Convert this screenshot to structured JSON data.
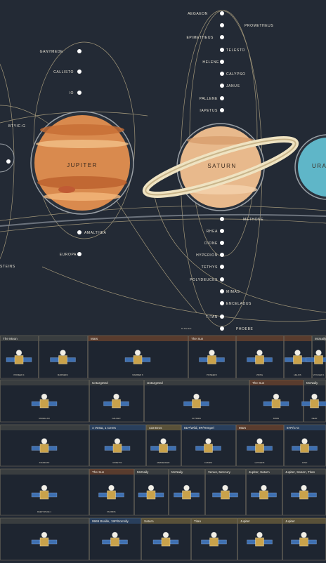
{
  "colors": {
    "background": "#232a35",
    "orbit": "#b7a985",
    "moon_dot": "#ffffff",
    "jupiter": "#d98a4e",
    "saturn": "#e8b98c",
    "uranus": "#5fb6c8",
    "panel": "#1e2530",
    "panel_border": "#6e6a5c",
    "accent_orange": "#c8682c",
    "accent_gold": "#c9a24b",
    "accent_blue": "#3e6fb0"
  },
  "planets": {
    "jupiter": {
      "label": "JUPITER",
      "icon": "jupiter-planet-icon"
    },
    "saturn": {
      "label": "SATURN",
      "icon": "saturn-planet-icon"
    },
    "uranus": {
      "label": "URAN",
      "icon": "uranus-planet-icon"
    }
  },
  "moons": {
    "jupiter": [
      "GANYMEDE",
      "CALLISTO",
      "IO",
      "EUROPA",
      "AMALTHEA"
    ],
    "saturn_upper": [
      "AEGAEON",
      "PROMETHEUS",
      "EPIMETHEUS",
      "TELESTO",
      "HELENE",
      "CALYPSO",
      "JANUS",
      "PALLENE",
      "IAPETUS"
    ],
    "saturn_lower": [
      "METHONE",
      "RHEA",
      "DIONE",
      "HYPERION",
      "TETHYS",
      "POLYDEUCES",
      "MIMAS",
      "ENCELADUS",
      "TITAN",
      "PHOEBE"
    ],
    "left_edge": [
      "STEINS"
    ],
    "other": [
      "BTYIC-G"
    ]
  },
  "orbit_notes": {
    "the_sun": "To The Sun"
  },
  "grid": {
    "rows": [
      [
        {
          "num": "",
          "title": "The Moon",
          "sub": "",
          "accent": "#6e6a5c"
        },
        {
          "num": "",
          "title": "",
          "sub": "Pioneer 4",
          "accent": "#6e6a5c"
        },
        {
          "num": "",
          "title": "Mars",
          "sub": "",
          "accent": "#c8682c"
        },
        {
          "num": "",
          "title": "The Sun",
          "sub": "",
          "accent": "#c8682c"
        },
        {
          "num": "",
          "title": "",
          "sub": "",
          "accent": "#c8682c"
        },
        {
          "num": "",
          "title": "",
          "sub": "",
          "accent": "#c8682c"
        },
        {
          "num": "",
          "title": "McNaily",
          "sub": "",
          "accent": "#6e6a5c"
        }
      ],
      [
        {
          "num": "",
          "title": "",
          "sub": "",
          "accent": "#6e6a5c"
        },
        {
          "num": "",
          "title": "Untargeted",
          "sub": "",
          "accent": "#6e6a5c"
        },
        {
          "num": "",
          "title": "Untargeted",
          "sub": "",
          "accent": "#6e6a5c"
        },
        {
          "num": "",
          "title": "The Sun",
          "sub": "",
          "accent": "#c8682c"
        },
        {
          "num": "",
          "title": "McNaily",
          "sub": "",
          "accent": "#6e6a5c"
        }
      ],
      [
        {
          "num": "",
          "title": "",
          "sub": "",
          "accent": "#6e6a5c"
        },
        {
          "num": "",
          "title": "4 Vesta, 1 Ceres",
          "sub": "",
          "accent": "#3e6fb0"
        },
        {
          "num": "",
          "title": "433 Eros",
          "sub": "",
          "accent": "#c9a24b"
        },
        {
          "num": "",
          "title": "81P/Wild, 9P/Tempel",
          "sub": "",
          "accent": "#3e6fb0"
        },
        {
          "num": "",
          "title": "Mars",
          "sub": "",
          "accent": "#c8682c"
        },
        {
          "num": "",
          "title": "67P/C-G",
          "sub": "",
          "accent": "#3e6fb0"
        }
      ],
      [
        {
          "num": "",
          "title": "",
          "sub": "",
          "accent": "#6e6a5c"
        },
        {
          "num": "",
          "title": "The Sun",
          "sub": "",
          "accent": "#c8682c"
        },
        {
          "num": "",
          "title": "McNaily",
          "sub": "",
          "accent": "#6e6a5c"
        },
        {
          "num": "",
          "title": "McNaily",
          "sub": "",
          "accent": "#6e6a5c"
        },
        {
          "num": "",
          "title": "Venus, Mercury",
          "sub": "",
          "accent": "#6e6a5c"
        },
        {
          "num": "",
          "title": "Jupiter, Saturn",
          "sub": "",
          "accent": "#6e6a5c"
        },
        {
          "num": "",
          "title": "Jupiter, Saturn, Titan",
          "sub": "",
          "accent": "#6e6a5c"
        }
      ],
      [
        {
          "num": "",
          "title": "",
          "sub": "",
          "accent": "#6e6a5c"
        },
        {
          "num": "",
          "title": "9969 Braille, 19P/Borrelly",
          "sub": "",
          "accent": "#3e6fb0"
        },
        {
          "num": "",
          "title": "Saturn",
          "sub": "",
          "accent": "#c9a24b"
        },
        {
          "num": "",
          "title": "Titan",
          "sub": "",
          "accent": "#c9a24b"
        },
        {
          "num": "",
          "title": "Jupiter",
          "sub": "",
          "accent": "#c9a24b"
        },
        {
          "num": "",
          "title": "Jupiter",
          "sub": "",
          "accent": "#c9a24b"
        }
      ]
    ],
    "captions": [
      "PIONEER 4",
      "MARINER 4",
      "MARINER 6",
      "PIONEER 6",
      "VIKING",
      "HELIOS",
      "VOYAGER 1",
      "MAGELLAN",
      "GALILEO",
      "ULYSSES",
      "DAWN",
      "NEAR",
      "STARDUST",
      "ROSETTA",
      "MESSENGER",
      "CASSINI",
      "HUYGENS",
      "JUNO",
      "DEEP SPACE 1",
      "PHOBOS"
    ]
  }
}
